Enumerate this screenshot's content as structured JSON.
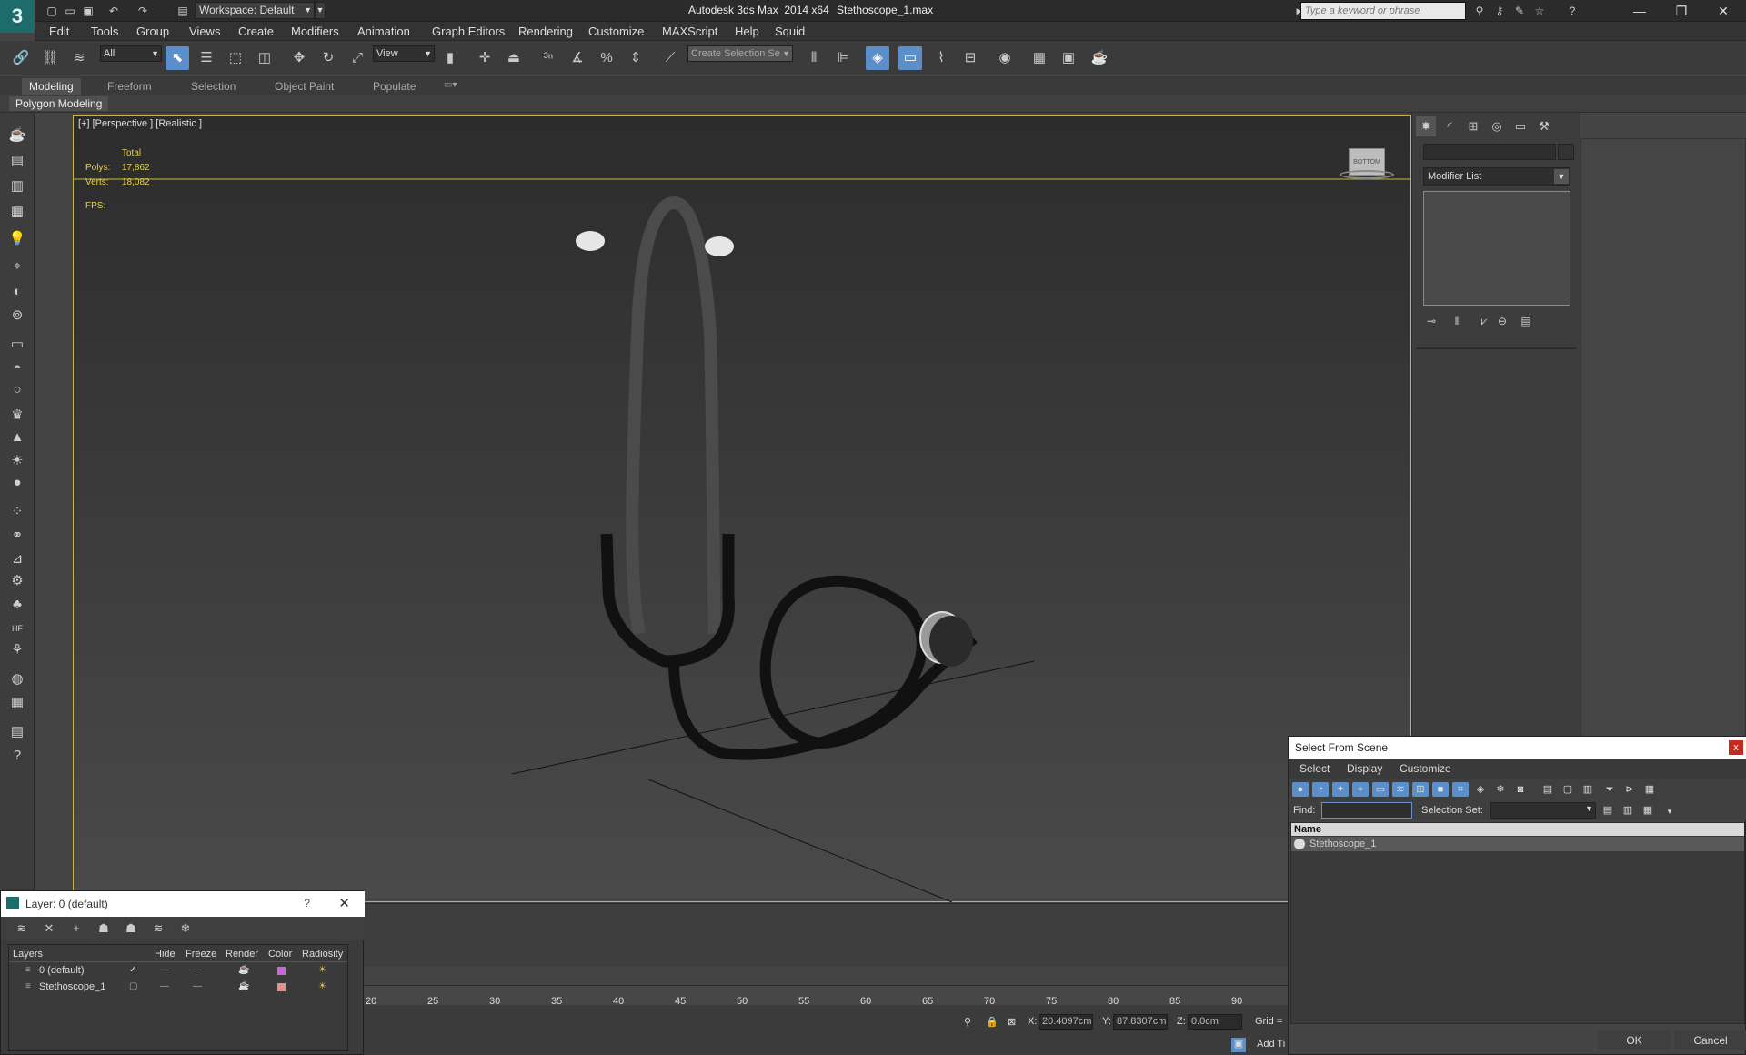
{
  "titlebar": {
    "logo": "3",
    "workspace": "Workspace: Default",
    "app_title": "Autodesk 3ds Max  2014 x64",
    "document": "Stethoscope_1.max",
    "search_placeholder": "Type a keyword or phrase",
    "minimize": "—",
    "maximize": "❐",
    "close": "✕"
  },
  "menu": [
    "Edit",
    "Tools",
    "Group",
    "Views",
    "Create",
    "Modifiers",
    "Animation",
    "Graph Editors",
    "Rendering",
    "Customize",
    "MAXScript",
    "Help",
    "Squid"
  ],
  "toolbar": {
    "filter_value": "All",
    "coord_value": "View",
    "selection_set_placeholder": "Create Selection Se"
  },
  "ribbon": {
    "tabs": [
      "Modeling",
      "Freeform",
      "Selection",
      "Object Paint",
      "Populate"
    ],
    "panel_label": "Polygon Modeling"
  },
  "viewport": {
    "label": "[+] [Perspective ] [Realistic ]",
    "stats_header": "Total",
    "polys_label": "Polys:",
    "polys_value": "17,862",
    "verts_label": "Verts:",
    "verts_value": "18,082",
    "fps_label": "FPS:",
    "viewcube_text": "BOTTOM"
  },
  "timeline": {
    "ticks": [
      "20",
      "25",
      "30",
      "35",
      "40",
      "45",
      "50",
      "55",
      "60",
      "65",
      "70",
      "75",
      "80",
      "85",
      "90"
    ]
  },
  "statusbar": {
    "x_label": "X:",
    "x_value": "20.4097cm",
    "y_label": "Y:",
    "y_value": "87.8307cm",
    "z_label": "Z:",
    "z_value": "0.0cm",
    "grid_label": "Grid =",
    "add_time_tag": "Add Ti"
  },
  "command_panel": {
    "modifier_list": "Modifier List"
  },
  "select_from_scene": {
    "title": "Select From Scene",
    "close": "x",
    "menu": [
      "Select",
      "Display",
      "Customize"
    ],
    "find_label": "Find:",
    "selection_set_label": "Selection Set:",
    "column_name": "Name",
    "items": [
      "Stethoscope_1"
    ],
    "ok": "OK",
    "cancel": "Cancel"
  },
  "layer_dialog": {
    "title": "Layer: 0 (default)",
    "help": "?",
    "close": "✕",
    "columns": [
      "Layers",
      "Hide",
      "Freeze",
      "Render",
      "Color",
      "Radiosity"
    ],
    "layers": [
      {
        "name": "0 (default)",
        "color": "#c46ad8"
      },
      {
        "name": "Stethoscope_1",
        "color": "#e89090"
      }
    ]
  }
}
